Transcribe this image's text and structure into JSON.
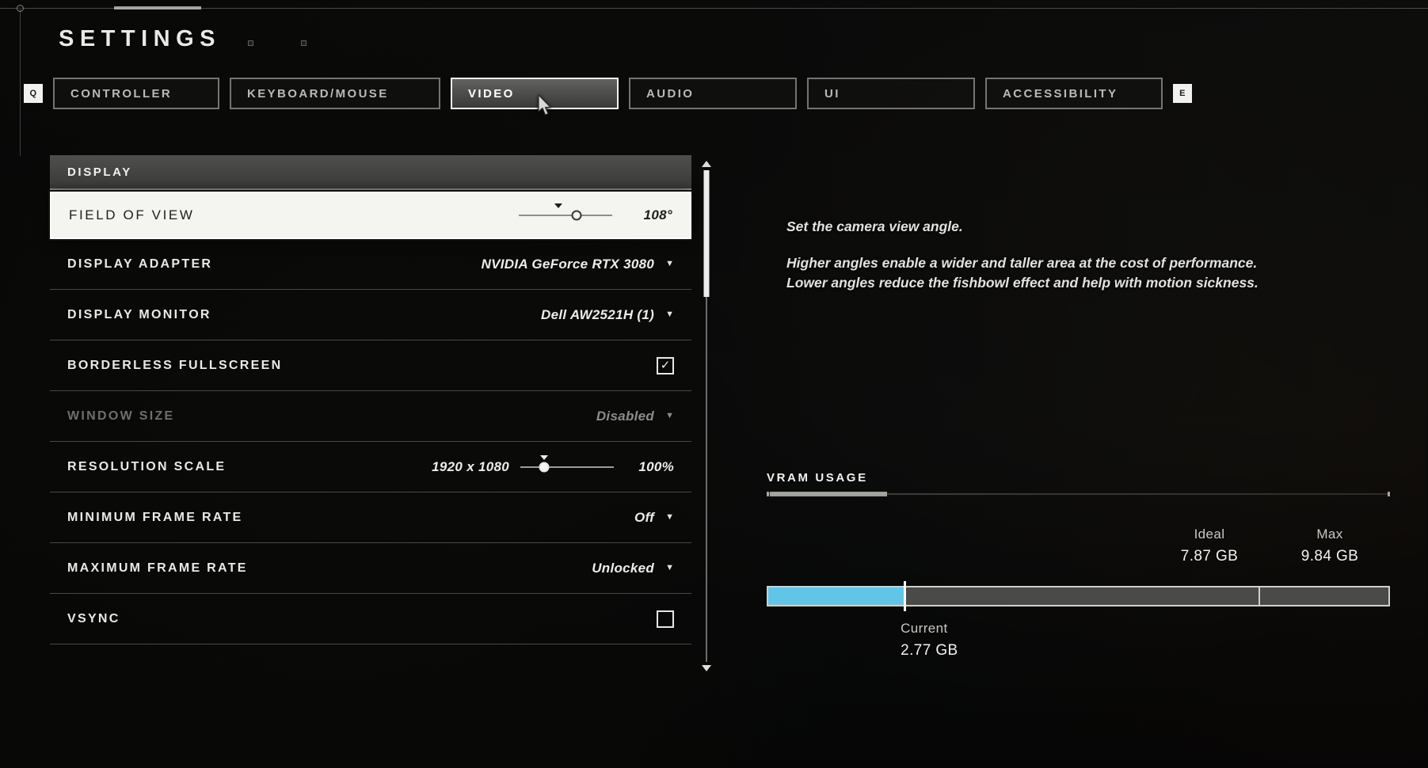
{
  "header": {
    "title": "SETTINGS",
    "prev_key": "Q",
    "next_key": "E"
  },
  "tabs": [
    {
      "label": "CONTROLLER",
      "active": false
    },
    {
      "label": "KEYBOARD/MOUSE",
      "active": false
    },
    {
      "label": "VIDEO",
      "active": true
    },
    {
      "label": "AUDIO",
      "active": false
    },
    {
      "label": "UI",
      "active": false
    },
    {
      "label": "ACCESSIBILITY",
      "active": false
    }
  ],
  "section": {
    "title": "DISPLAY"
  },
  "rows": {
    "field_of_view": {
      "label": "FIELD OF VIEW",
      "value": "108°",
      "slider_percent": 62
    },
    "display_adapter": {
      "label": "DISPLAY ADAPTER",
      "value": "NVIDIA GeForce RTX 3080",
      "caret": "▼"
    },
    "display_monitor": {
      "label": "DISPLAY MONITOR",
      "value": "Dell AW2521H (1)",
      "caret": "▼"
    },
    "borderless_fullscreen": {
      "label": "BORDERLESS FULLSCREEN",
      "checked_glyph": "✓"
    },
    "window_size": {
      "label": "WINDOW SIZE",
      "value": "Disabled",
      "caret": "▼"
    },
    "resolution_scale": {
      "label": "RESOLUTION SCALE",
      "resolution": "1920 x 1080",
      "value": "100%",
      "slider_percent": 25
    },
    "minimum_frame_rate": {
      "label": "MINIMUM FRAME RATE",
      "value": "Off",
      "caret": "▼"
    },
    "maximum_frame_rate": {
      "label": "MAXIMUM FRAME RATE",
      "value": "Unlocked",
      "caret": "▼"
    },
    "vsync": {
      "label": "VSYNC",
      "checked_glyph": ""
    }
  },
  "description": {
    "line1": "Set the camera view angle.",
    "line2": "Higher angles enable a wider and taller area at the cost of performance.",
    "line3": "Lower angles reduce the fishbowl effect and help with motion sickness."
  },
  "vram": {
    "title": "VRAM USAGE",
    "ideal_label": "Ideal",
    "ideal_value": "7.87 GB",
    "max_label": "Max",
    "max_value": "9.84 GB",
    "current_label": "Current",
    "current_value": "2.77 GB",
    "fill_percent": 22,
    "marker_percent": 22,
    "divider_percent": 79,
    "fill_color": "#61c5e8"
  }
}
